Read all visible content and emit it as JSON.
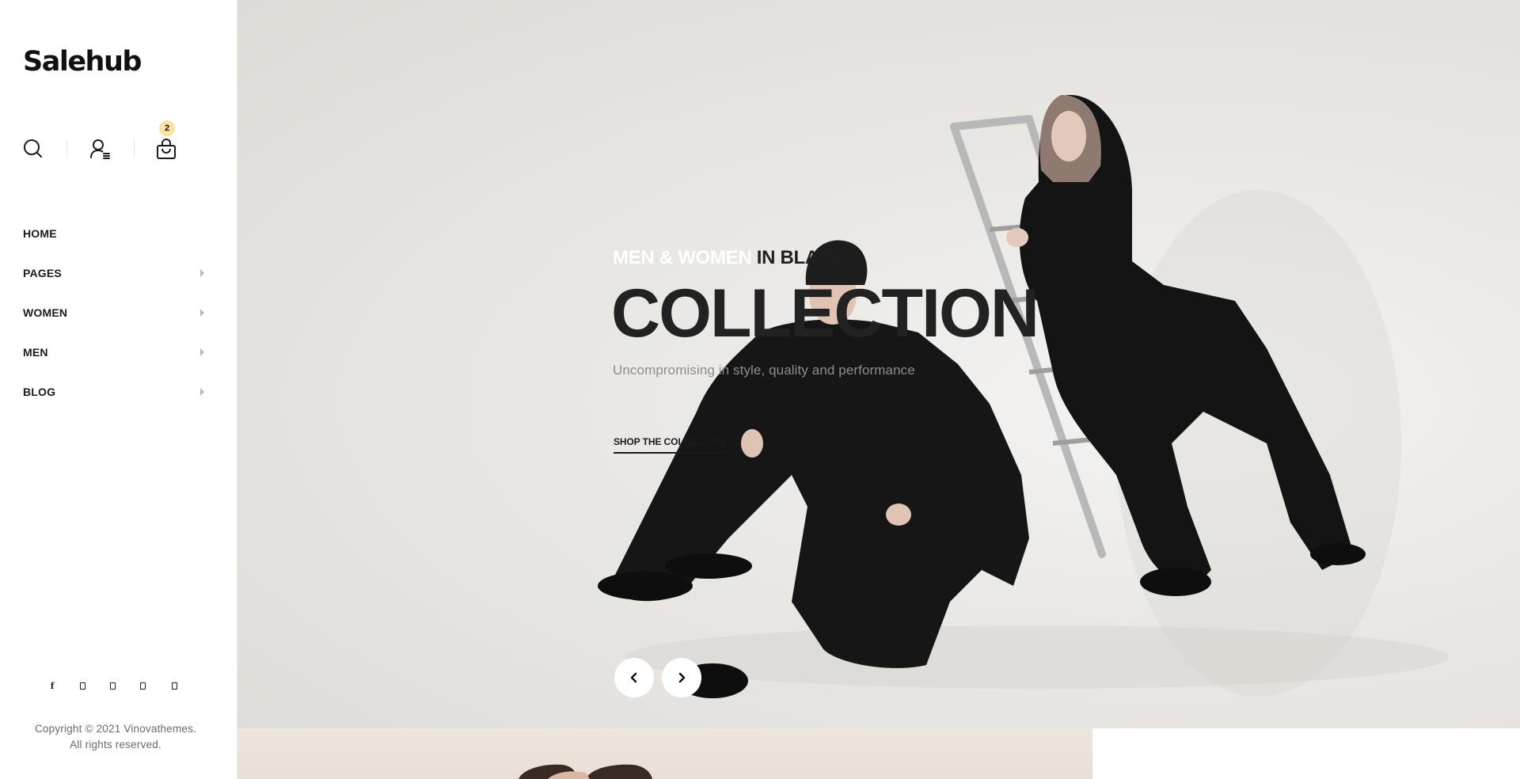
{
  "brand": {
    "name": "Salehub"
  },
  "header": {
    "icons": [
      "search-icon",
      "account-icon",
      "shopping-bag-icon"
    ],
    "cart_count": "2",
    "badge_color": "#fbe3a6"
  },
  "nav": {
    "items": [
      {
        "label": "HOME",
        "has_submenu": false
      },
      {
        "label": "PAGES",
        "has_submenu": true
      },
      {
        "label": "WOMEN",
        "has_submenu": true
      },
      {
        "label": "MEN",
        "has_submenu": true
      },
      {
        "label": "BLOG",
        "has_submenu": true
      }
    ]
  },
  "social": {
    "items": [
      "facebook-icon",
      "twitter-icon",
      "instagram-icon",
      "pinterest-icon",
      "youtube-icon"
    ],
    "facebook_glyph": "f"
  },
  "footer": {
    "copyright_line1": "Copyright © 2021 Vinovathemes.",
    "copyright_line2": "All rights reserved."
  },
  "hero": {
    "eyebrow_light": "MEN & WOMEN",
    "eyebrow_dark": "IN BLACK",
    "title": "COLLECTION",
    "subtitle": "Uncompromising in style, quality and performance",
    "cta": "SHOP THE COLLECTION",
    "slider_controls": [
      "chevron-left-icon",
      "chevron-right-icon"
    ]
  },
  "colors": {
    "hero_background": "#e6e3e0",
    "text_dark": "#222222",
    "text_muted": "#8d8d8d",
    "eyebrow_light": "#ffffff"
  }
}
